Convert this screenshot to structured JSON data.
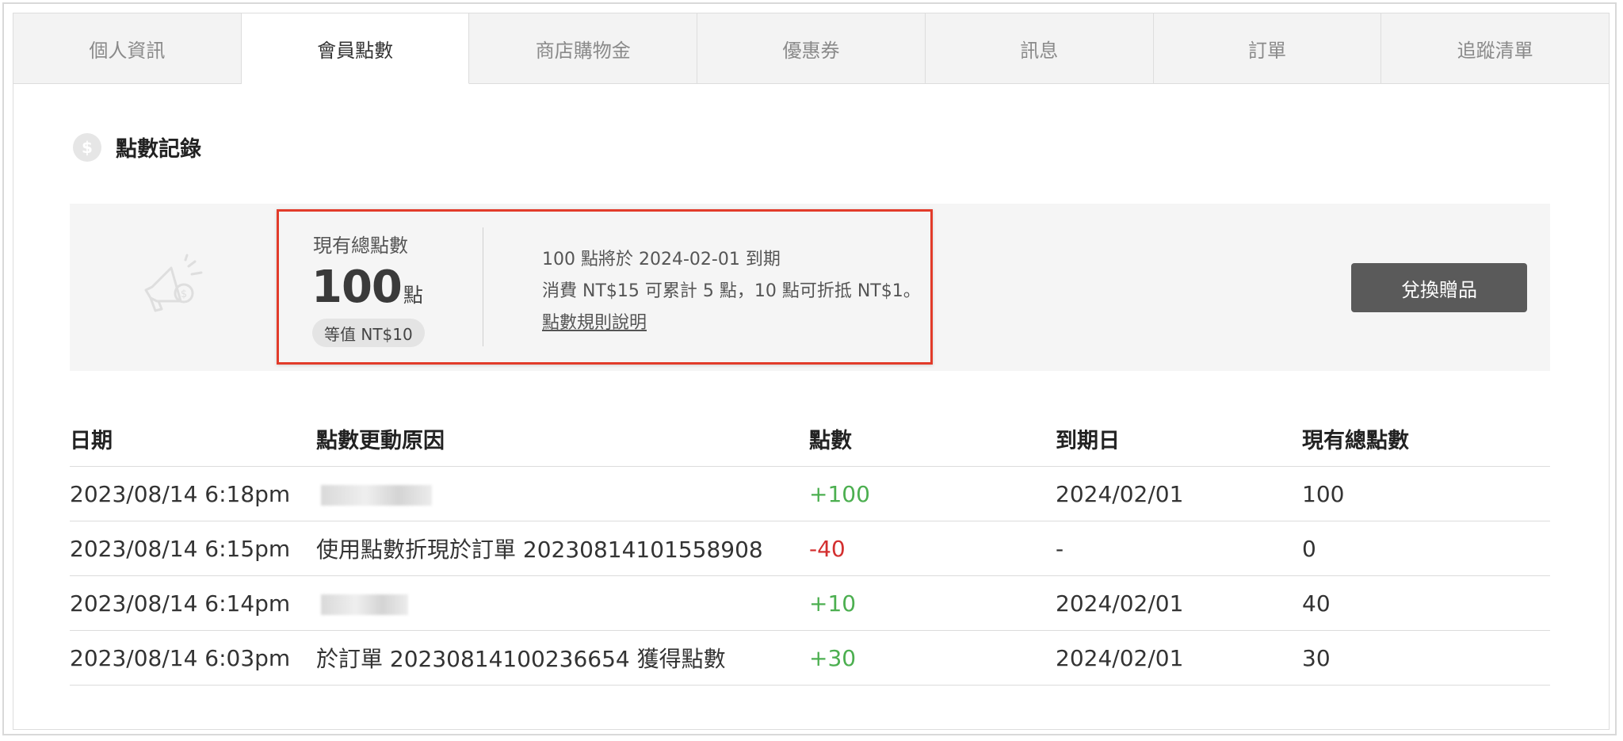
{
  "tabs": [
    {
      "label": "個人資訊",
      "active": false
    },
    {
      "label": "會員點數",
      "active": true
    },
    {
      "label": "商店購物金",
      "active": false
    },
    {
      "label": "優惠券",
      "active": false
    },
    {
      "label": "訊息",
      "active": false
    },
    {
      "label": "訂單",
      "active": false
    },
    {
      "label": "追蹤清單",
      "active": false
    }
  ],
  "section": {
    "icon": "dollar-coin-icon",
    "title": "點數記錄"
  },
  "summary": {
    "icon": "megaphone-icon",
    "total_label": "現有總點數",
    "total_value": "100",
    "total_unit": "點",
    "equivalent": "等值 NT$10",
    "expiry_note": "100 點將於 2024-02-01 到期",
    "earn_rule": "消費 NT$15 可累計 5 點，10 點可折抵 NT$1。",
    "rules_link": "點數規則說明",
    "redeem_button": "兌換贈品"
  },
  "table": {
    "headers": [
      "日期",
      "點數更動原因",
      "點數",
      "到期日",
      "現有總點數"
    ],
    "rows": [
      {
        "date": "2023/08/14 6:18pm",
        "reason": "",
        "points": "+100",
        "expiry": "2024/02/01",
        "total": "100"
      },
      {
        "date": "2023/08/14 6:15pm",
        "reason": "使用點數折現於訂單 20230814101558908",
        "points": "-40",
        "expiry": "-",
        "total": "0"
      },
      {
        "date": "2023/08/14 6:14pm",
        "reason": "",
        "points": "+10",
        "expiry": "2024/02/01",
        "total": "40"
      },
      {
        "date": "2023/08/14 6:03pm",
        "reason": "於訂單 20230814100236654 獲得點數",
        "points": "+30",
        "expiry": "2024/02/01",
        "total": "30"
      }
    ]
  },
  "colors": {
    "positive": "#4caf50",
    "negative": "#d32f2f",
    "highlight_border": "#e23b2a",
    "button_bg": "#5a5a5a"
  }
}
